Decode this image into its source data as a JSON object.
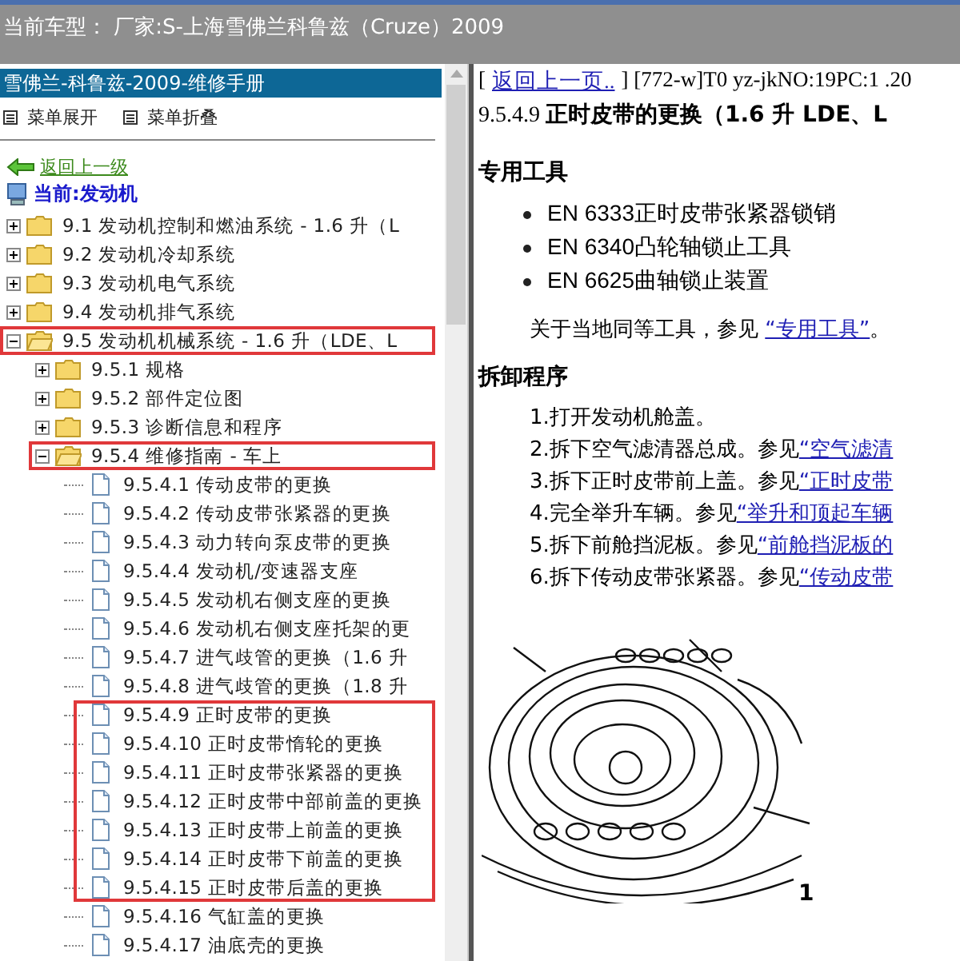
{
  "title_bar": {
    "title": "当前车型： 厂家:S-上海雪佛兰科鲁兹（Cruze）2009"
  },
  "sidebar": {
    "header": "雪佛兰-科鲁兹-2009-维修手册",
    "menu_buttons": [
      "菜单展开",
      "菜单折叠"
    ],
    "back_link": "返回上一级",
    "current": "当前:发动机",
    "tree": [
      {
        "kind": "folder",
        "label": "9.1 发动机控制和燃油系统 - 1.6 升（L",
        "expanded": false,
        "highlighted": false
      },
      {
        "kind": "folder",
        "label": "9.2 发动机冷却系统",
        "expanded": false,
        "highlighted": false
      },
      {
        "kind": "folder",
        "label": "9.3 发动机电气系统",
        "expanded": false,
        "highlighted": false
      },
      {
        "kind": "folder",
        "label": "9.4 发动机排气系统",
        "expanded": false,
        "highlighted": false
      },
      {
        "kind": "folder",
        "label": "9.5 发动机机械系统 - 1.6 升（LDE、L",
        "expanded": true,
        "highlighted": true,
        "children": [
          {
            "kind": "folder",
            "label": "9.5.1 规格",
            "expanded": false,
            "highlighted": false
          },
          {
            "kind": "folder",
            "label": "9.5.2 部件定位图",
            "expanded": false,
            "highlighted": false
          },
          {
            "kind": "folder",
            "label": "9.5.3 诊断信息和程序",
            "expanded": false,
            "highlighted": false
          },
          {
            "kind": "folder",
            "label": "9.5.4 维修指南 - 车上",
            "expanded": true,
            "highlighted": true,
            "children": [
              {
                "kind": "page",
                "label": "9.5.4.1 传动皮带的更换",
                "highlighted": false
              },
              {
                "kind": "page",
                "label": "9.5.4.2 传动皮带张紧器的更换",
                "highlighted": false
              },
              {
                "kind": "page",
                "label": "9.5.4.3 动力转向泵皮带的更换",
                "highlighted": false
              },
              {
                "kind": "page",
                "label": "9.5.4.4 发动机/变速器支座",
                "highlighted": false
              },
              {
                "kind": "page",
                "label": "9.5.4.5 发动机右侧支座的更换",
                "highlighted": false
              },
              {
                "kind": "page",
                "label": "9.5.4.6 发动机右侧支座托架的更",
                "highlighted": false
              },
              {
                "kind": "page",
                "label": "9.5.4.7 进气歧管的更换（1.6 升",
                "highlighted": false
              },
              {
                "kind": "page",
                "label": "9.5.4.8 进气歧管的更换（1.8 升",
                "highlighted": false
              },
              {
                "kind": "page",
                "label": "9.5.4.9 正时皮带的更换",
                "highlighted": true
              },
              {
                "kind": "page",
                "label": "9.5.4.10 正时皮带惰轮的更换",
                "highlighted": true
              },
              {
                "kind": "page",
                "label": "9.5.4.11 正时皮带张紧器的更换",
                "highlighted": true
              },
              {
                "kind": "page",
                "label": "9.5.4.12 正时皮带中部前盖的更换",
                "highlighted": true
              },
              {
                "kind": "page",
                "label": "9.5.4.13 正时皮带上前盖的更换",
                "highlighted": true
              },
              {
                "kind": "page",
                "label": "9.5.4.14 正时皮带下前盖的更换",
                "highlighted": true
              },
              {
                "kind": "page",
                "label": "9.5.4.15 正时皮带后盖的更换",
                "highlighted": true
              },
              {
                "kind": "page",
                "label": "9.5.4.16 气缸盖的更换",
                "highlighted": false
              },
              {
                "kind": "page",
                "label": "9.5.4.17 油底壳的更换",
                "highlighted": false
              }
            ]
          }
        ]
      }
    ]
  },
  "document": {
    "bracket": "[",
    "back_link": "返回上一页..",
    "ref": "] [772-w]T0 yz-jkNO:19PC:1 .20",
    "title": "9.5.4.9 **正时皮带的更换（1.6 升 LDE、L**",
    "sections": [
      {
        "heading": "专用工具",
        "bullets": [
          "EN 6333正时皮带张紧器锁销",
          "EN 6340凸轮轴锁止工具",
          "EN 6625曲轴锁止装置"
        ],
        "note": {
          "text": "关于当地同等工具，参见",
          "link": "“专用工具”",
          "end": "。"
        }
      },
      {
        "heading": "拆卸程序",
        "steps": [
          {
            "text": "1.打开发动机舱盖。"
          },
          {
            "text": "2.拆下空气滤清器总成。参见",
            "link": "“空气滤清"
          },
          {
            "text": "3.拆下正时皮带前上盖。参见",
            "link": "“正时皮带"
          },
          {
            "text": "4.完全举升车辆。参见",
            "link": "“举升和顶起车辆"
          },
          {
            "text": "5.拆下前舱挡泥板。参见",
            "link": "“前舱挡泥板的"
          },
          {
            "text": "6.拆下传动皮带张紧器。参见",
            "link": "“传动皮带"
          }
        ]
      }
    ],
    "figure_callout": "1"
  }
}
